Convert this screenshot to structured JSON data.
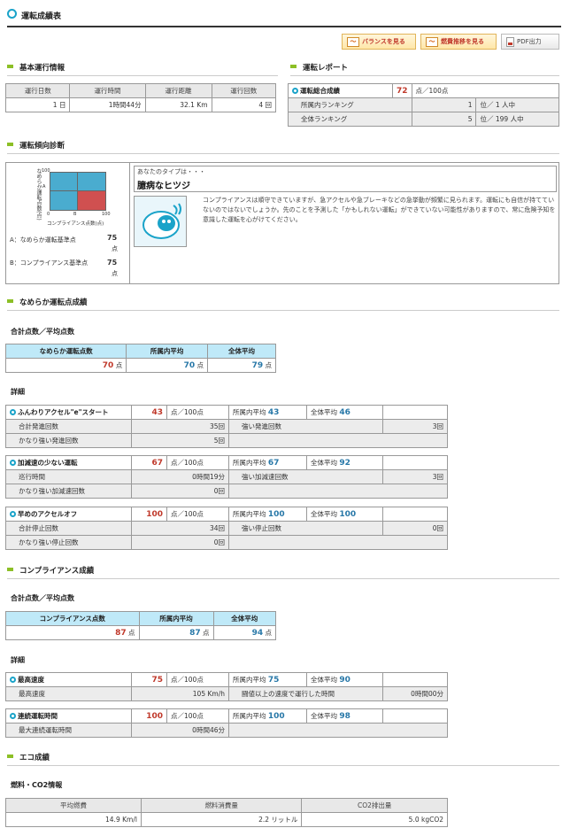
{
  "page": {
    "title": "運転成績表"
  },
  "toolbar": {
    "balance": "バランスを見る",
    "fuel": "燃費推移を見る",
    "pdf": "PDF出力"
  },
  "basic": {
    "heading": "基本運行情報",
    "headers": [
      "運行日数",
      "運行時間",
      "運行距離",
      "運行回数"
    ],
    "values": [
      "1 日",
      "1時間44分",
      "32.1 Km",
      "4 回"
    ]
  },
  "report": {
    "heading": "運転レポート",
    "score_label": "運転総合成績",
    "score": "72",
    "score_unit": "点／100点",
    "office_rank_label": "所属内ランキング",
    "office_rank": "1",
    "office_rank_unit": "位／ 1 人中",
    "all_rank_label": "全体ランキング",
    "all_rank": "5",
    "all_rank_unit": "位／ 199 人中"
  },
  "diagnosis": {
    "heading": "運転傾向診断",
    "chart_ylabel": "なめらか運転点数(点)",
    "chart_xlabel": "コンプライアンス点数(点)",
    "y100": "100",
    "x0": "0",
    "x100": "100",
    "a_label": "A：なめらか運転基準点",
    "a_value": "75",
    "a_unit": "点",
    "b_label": "B：コンプライアンス基準点",
    "b_value": "75",
    "b_unit": "点",
    "type_intro": "あなたのタイプは・・・",
    "type_name": "臆病なヒツジ",
    "type_desc": "コンプライアンスは順守できていますが、急アクセルや急ブレーキなどの急挙動が頻繁に見られます。運転にも自信が持てていないのではないでしょうか。先のことを予測した「かもしれない運転」ができていない可能性がありますので、常に危険予知を意識した運転を心がけてください。",
    "chart_a": "A",
    "chart_b": "B"
  },
  "smooth": {
    "heading": "なめらか運転点成績",
    "total_heading": "合計点数／平均点数",
    "headers": [
      "なめらか運転点数",
      "所属内平均",
      "全体平均"
    ],
    "values": [
      "70",
      "70",
      "79"
    ],
    "unit": "点",
    "detail_heading": "詳細",
    "items": [
      {
        "name": "ふんわりアクセル\"e\"スタート",
        "score": "43",
        "avg_office": "43",
        "avg_all": "46",
        "rows": [
          [
            "合計発進回数",
            "35回",
            "強い発進回数",
            "3回"
          ],
          [
            "かなり強い発進回数",
            "5回",
            "",
            ""
          ]
        ]
      },
      {
        "name": "加減速の少ない運転",
        "score": "67",
        "avg_office": "67",
        "avg_all": "92",
        "rows": [
          [
            "巡行時間",
            "0時間19分",
            "強い加減速回数",
            "3回"
          ],
          [
            "かなり強い加減速回数",
            "0回",
            "",
            ""
          ]
        ]
      },
      {
        "name": "早めのアクセルオフ",
        "score": "100",
        "avg_office": "100",
        "avg_all": "100",
        "rows": [
          [
            "合計停止回数",
            "34回",
            "強い停止回数",
            "0回"
          ],
          [
            "かなり強い停止回数",
            "0回",
            "",
            ""
          ]
        ]
      }
    ]
  },
  "common": {
    "score_unit": "点／100点",
    "office_avg": "所属内平均",
    "all_avg": "全体平均"
  },
  "compliance": {
    "heading": "コンプライアンス成績",
    "total_heading": "合計点数／平均点数",
    "headers": [
      "コンプライアンス点数",
      "所属内平均",
      "全体平均"
    ],
    "values": [
      "87",
      "87",
      "94"
    ],
    "unit": "点",
    "detail_heading": "詳細",
    "items": [
      {
        "name": "最高速度",
        "score": "75",
        "avg_office": "75",
        "avg_all": "90",
        "rows": [
          [
            "最高速度",
            "105 Km/h",
            "闘値以上の速度で運行した時間",
            "0時間00分"
          ]
        ]
      },
      {
        "name": "連続運転時間",
        "score": "100",
        "avg_office": "100",
        "avg_all": "98",
        "rows": [
          [
            "最大連続運転時間",
            "0時間46分",
            "",
            ""
          ]
        ]
      }
    ]
  },
  "eco": {
    "heading": "エコ成績",
    "sub": "燃料・CO2情報",
    "headers": [
      "平均燃費",
      "燃料消費量",
      "CO2排出量"
    ],
    "values": [
      "14.9 Km/l",
      "2.2 リットル",
      "5.0 kgCO2"
    ]
  },
  "colors": {
    "accent": "#1aa3c9",
    "bullet": "#8cbf26",
    "score_red": "#c0392b",
    "avg_blue": "#2878a8",
    "header_blue": "#bfe9f8",
    "chart_blue": "#4aaccf",
    "chart_red": "#d05050"
  }
}
